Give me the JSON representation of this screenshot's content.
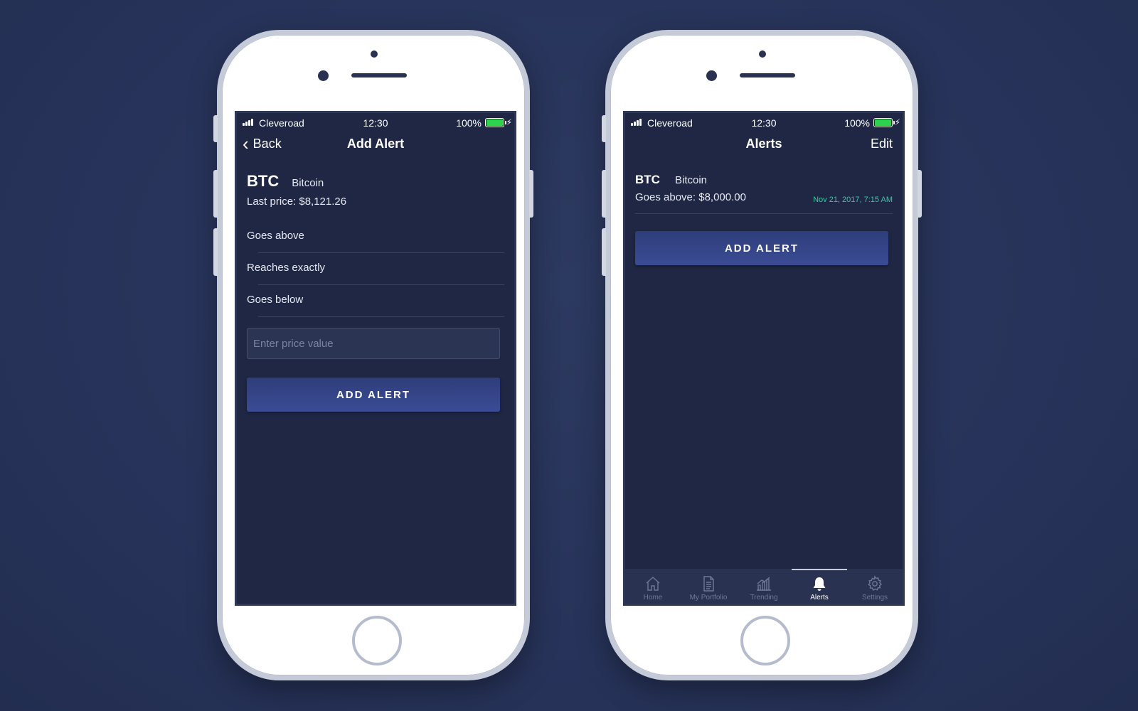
{
  "status": {
    "carrier": "Cleveroad",
    "time": "12:30",
    "battery": "100%"
  },
  "add_alert_screen": {
    "back_label": "Back",
    "title": "Add Alert",
    "coin_symbol": "BTC",
    "coin_name": "Bitcoin",
    "last_price": "Last price: $8,121.26",
    "options": [
      "Goes above",
      "Reaches exactly",
      "Goes below"
    ],
    "price_placeholder": "Enter price value",
    "button_label": "ADD ALERT"
  },
  "alerts_screen": {
    "title": "Alerts",
    "edit_label": "Edit",
    "alerts": [
      {
        "symbol": "BTC",
        "name": "Bitcoin",
        "condition": "Goes above: $8,000.00",
        "date": "Nov 21, 2017, 7:15 AM"
      }
    ],
    "button_label": "ADD ALERT",
    "tabs": [
      {
        "label": "Home",
        "icon": "home-icon"
      },
      {
        "label": "My Portfolio",
        "icon": "document-icon"
      },
      {
        "label": "Trending",
        "icon": "bar-chart-icon"
      },
      {
        "label": "Alerts",
        "icon": "bell-icon",
        "active": true
      },
      {
        "label": "Settings",
        "icon": "gear-icon"
      }
    ]
  },
  "colors": {
    "background": "#27335a",
    "screen": "#1f2744",
    "button": "#34448a",
    "date_accent": "#36c9a1",
    "battery": "#2fd24e"
  }
}
